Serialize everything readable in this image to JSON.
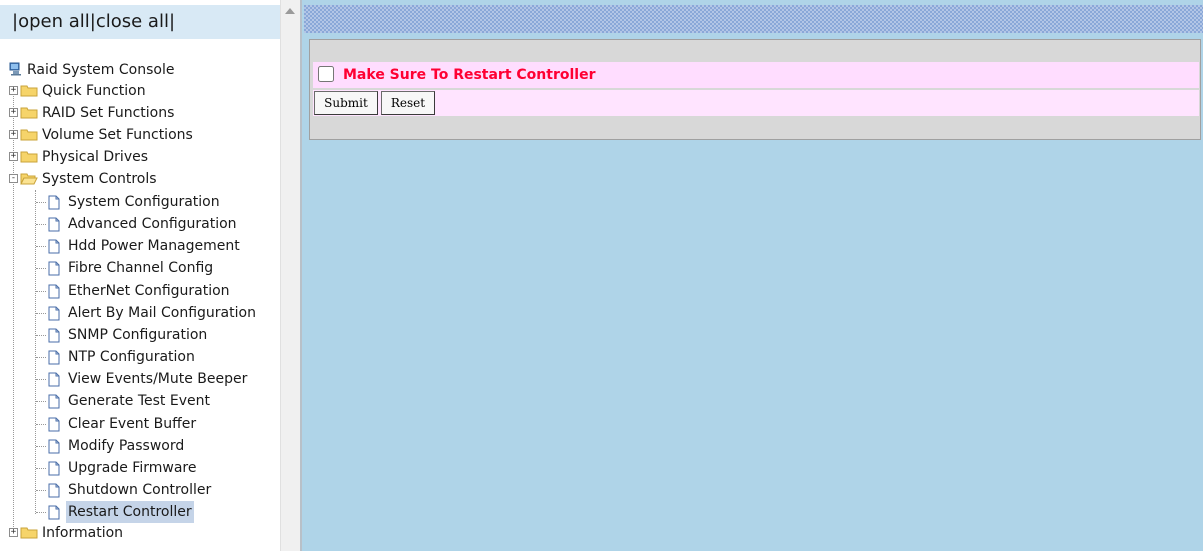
{
  "openclose": {
    "sep1": "|",
    "open_all": "open all",
    "sep2": "|",
    "close_all": "close all",
    "sep3": "|"
  },
  "tree": {
    "root": "Raid System Console",
    "folders": [
      {
        "label": "Quick Function",
        "expander": "+"
      },
      {
        "label": "RAID Set Functions",
        "expander": "+"
      },
      {
        "label": "Volume Set Functions",
        "expander": "+"
      },
      {
        "label": "Physical Drives",
        "expander": "+"
      },
      {
        "label": "System Controls",
        "expander": "-"
      }
    ],
    "system_controls_items": [
      "System Configuration",
      "Advanced Configuration",
      "Hdd Power Management",
      "Fibre Channel Config",
      "EtherNet Configuration",
      "Alert By Mail Configuration",
      "SNMP Configuration",
      "NTP Configuration",
      "View Events/Mute Beeper",
      "Generate Test Event",
      "Clear Event Buffer",
      "Modify Password",
      "Upgrade Firmware",
      "Shutdown Controller",
      "Restart Controller"
    ],
    "selected_item": "Restart Controller",
    "last_folder": {
      "label": "Information",
      "expander": "+"
    }
  },
  "form": {
    "checkbox_label": "Make Sure To Restart Controller",
    "checkbox_checked": false,
    "submit_label": "Submit",
    "reset_label": "Reset"
  },
  "colors": {
    "right_background": "#afd4e8",
    "form_row": "#ffddff",
    "warning_text": "#ff0033",
    "selected_item": "#c5d4e8"
  }
}
